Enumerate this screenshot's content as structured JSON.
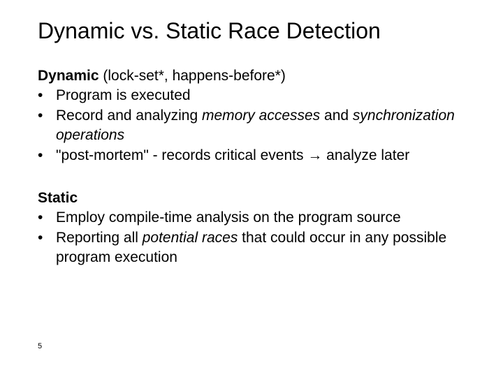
{
  "title": "Dynamic vs. Static Race Detection",
  "dynamic": {
    "head": "Dynamic",
    "sub": "   (lock-set*, happens-before*)",
    "b1": "Program is executed",
    "b2a": "Record and analyzing  ",
    "b2i": "memory accesses",
    "b2b": " and ",
    "b2i2": "synchronization operations",
    "b3": "\"post-mortem\" - records critical events → analyze later"
  },
  "static": {
    "head": "Static",
    "b1": "Employ compile-time analysis on the program source",
    "b2a": "Reporting all ",
    "b2i": "potential races",
    "b2b": " that could occur in any possible program execution"
  },
  "page": "5"
}
